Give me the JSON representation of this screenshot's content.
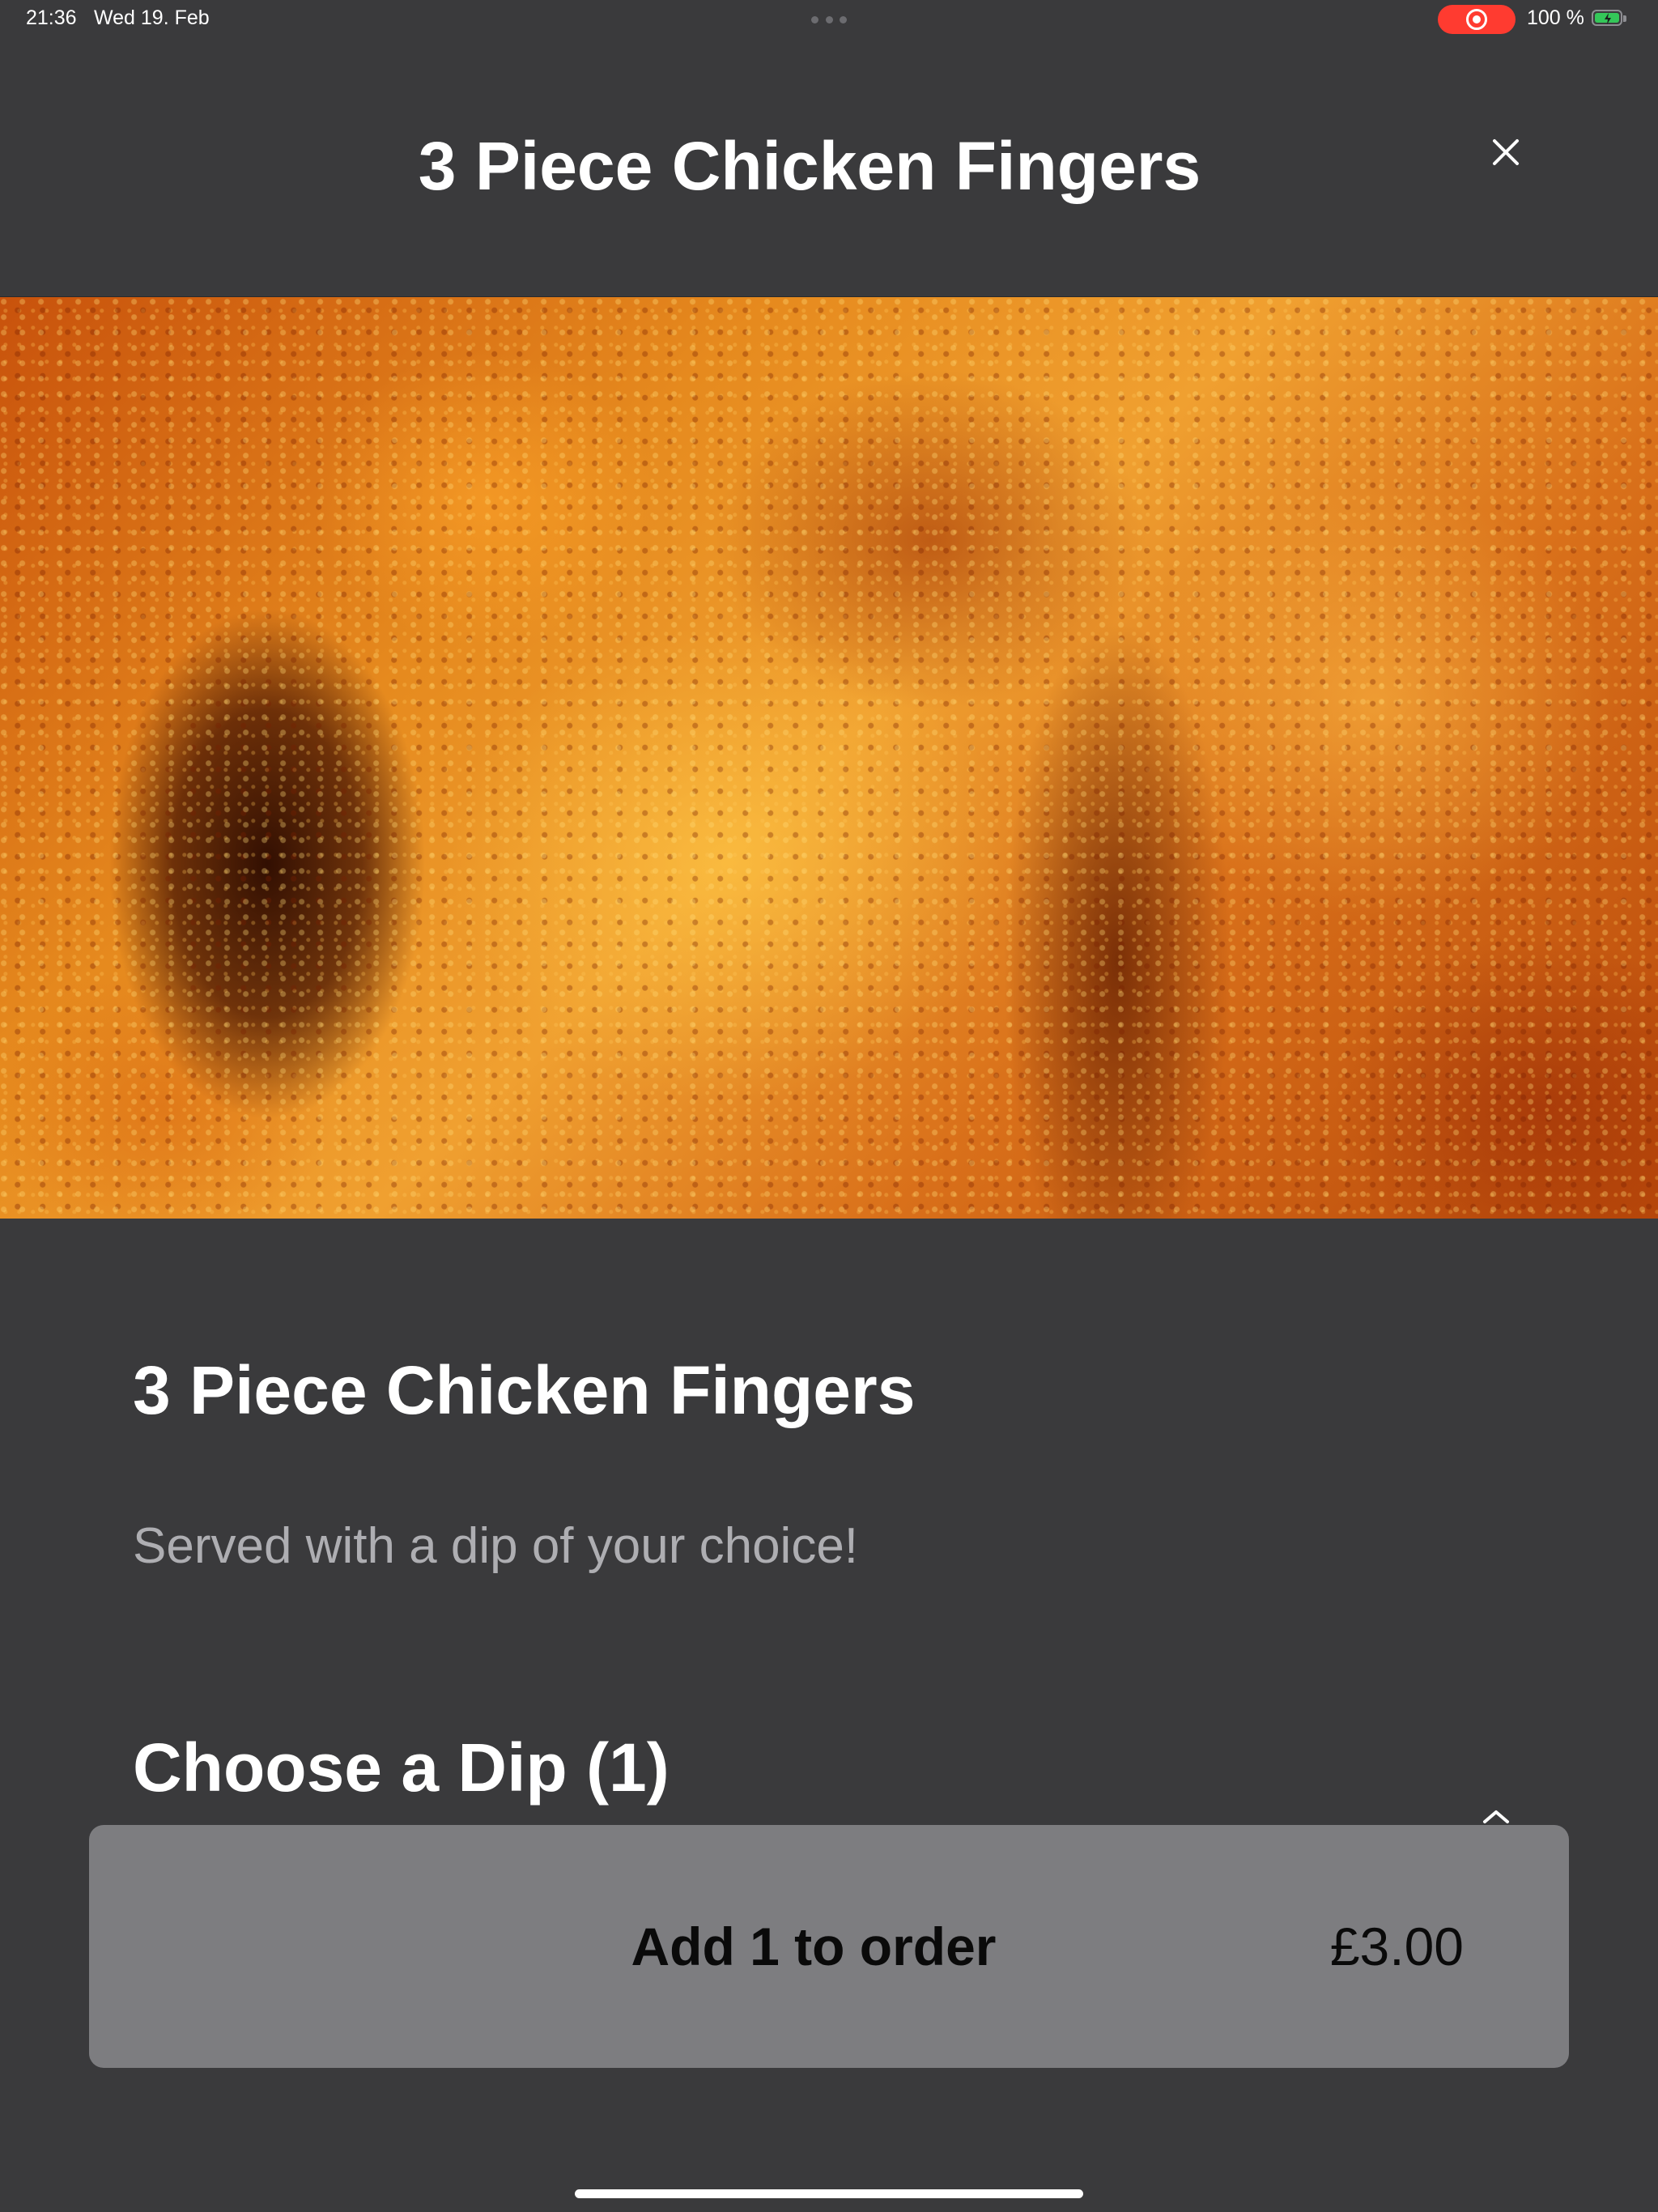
{
  "status_bar": {
    "time": "21:36",
    "date": "Wed 19. Feb",
    "battery_percent": "100 %",
    "battery_level": 1.0,
    "recording_indicator_color": "#ff3b30",
    "battery_fill_color": "#34c759"
  },
  "header": {
    "title": "3 Piece Chicken Fingers",
    "close_icon": "close-icon"
  },
  "hero": {
    "image": "fried-chicken-photo"
  },
  "item": {
    "name": "3 Piece Chicken Fingers",
    "description": "Served with a dip of your choice!"
  },
  "options": {
    "heading": "Choose a Dip (1)",
    "chevron_icon": "chevron-up-icon"
  },
  "order_button": {
    "label": "Add 1 to order",
    "price": "£3.00"
  },
  "colors": {
    "background": "#3a3a3c",
    "button_background": "#7d7d80",
    "description_text": "#aeaeb2"
  }
}
